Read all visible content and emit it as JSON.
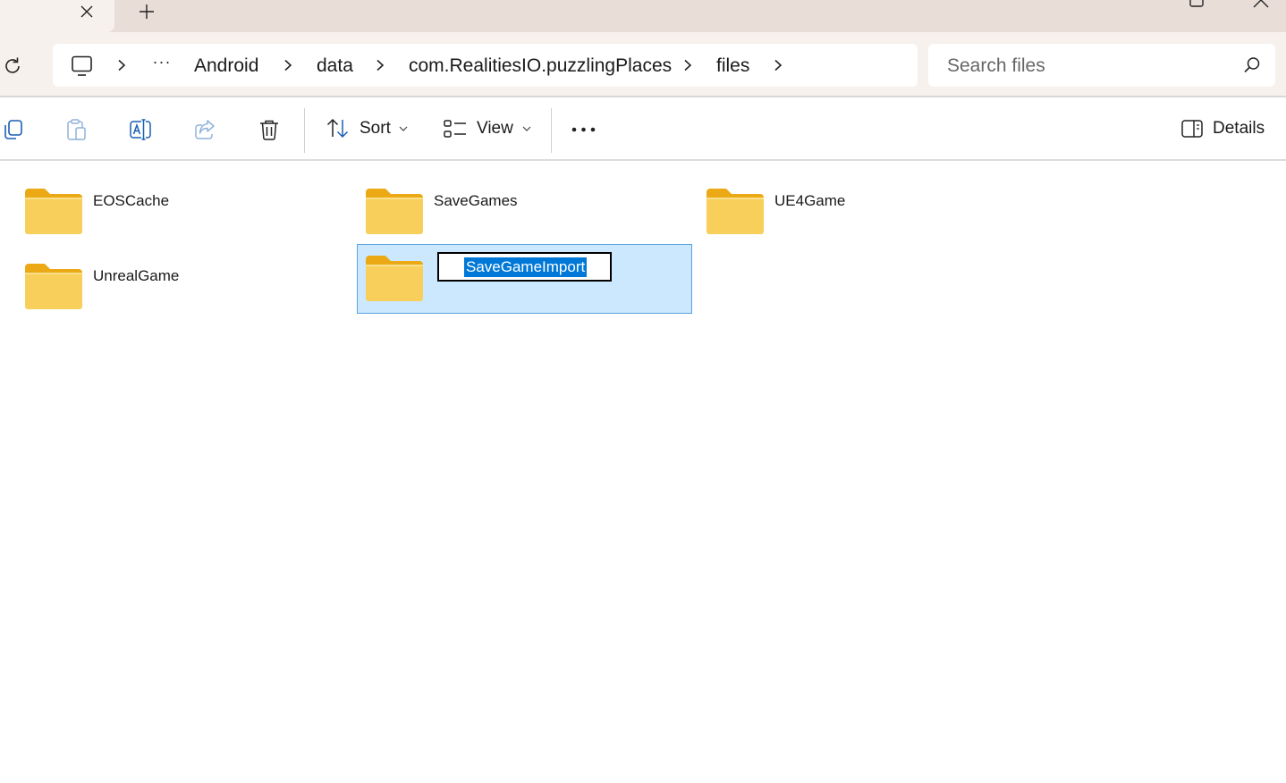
{
  "titlebar": {
    "tab_close_icon": "close-icon",
    "new_tab_icon": "plus-icon",
    "maximize_icon": "maximize-icon",
    "window_close_icon": "close-icon"
  },
  "navigation": {
    "refresh_icon": "refresh-icon",
    "root_icon": "this-pc-icon",
    "overflow": "···",
    "breadcrumbs": [
      "Android",
      "data",
      "com.RealitiesIO.puzzlingPlaces",
      "files"
    ],
    "separator_icon": "chevron-right-icon"
  },
  "search": {
    "placeholder": "Search files",
    "icon": "search-icon"
  },
  "commandbar": {
    "icons": [
      "copy-icon",
      "paste-icon",
      "rename-icon",
      "share-icon",
      "delete-icon"
    ],
    "sort_label": "Sort",
    "view_label": "View",
    "more_icon": "more-icon",
    "details_label": "Details"
  },
  "colors": {
    "tab_strip": "#e9ddd7",
    "nav_background": "#f7f1ee",
    "selection_fill": "#cce8ff",
    "selection_border": "#5aa2e0",
    "text_highlight": "#0078d7",
    "folder_yellow": "#f8cf5a"
  },
  "folders": [
    {
      "name": "EOSCache"
    },
    {
      "name": "SaveGames"
    },
    {
      "name": "UE4Game"
    },
    {
      "name": "UnrealGame"
    }
  ],
  "renaming_folder": {
    "name": "SaveGameImport",
    "state": "rename-in-progress, text selected"
  }
}
